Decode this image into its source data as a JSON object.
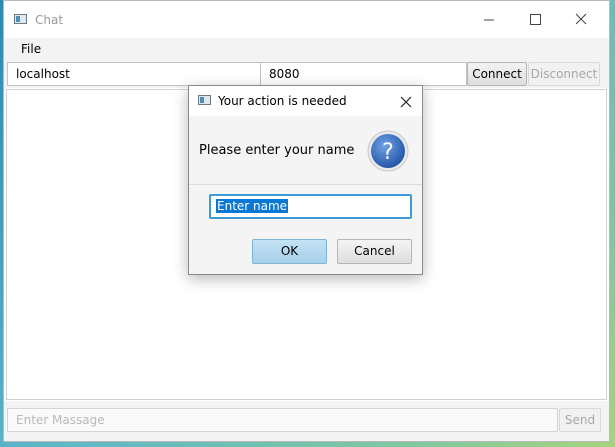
{
  "window": {
    "title": "Chat",
    "menu": {
      "file": "File"
    },
    "connection": {
      "host": "localhost",
      "port": "8080",
      "connect_label": "Connect",
      "disconnect_label": "Disconnect"
    },
    "message": {
      "placeholder": "Enter Massage",
      "send_label": "Send"
    }
  },
  "dialog": {
    "title": "Your action is needed",
    "header_text": "Please enter your name",
    "input_value": "Enter name",
    "ok_label": "OK",
    "cancel_label": "Cancel",
    "icon": "question-icon"
  },
  "colors": {
    "accent": "#3c9bd6",
    "question_icon": "#2f6fc4",
    "selection": "#0a78d4"
  }
}
